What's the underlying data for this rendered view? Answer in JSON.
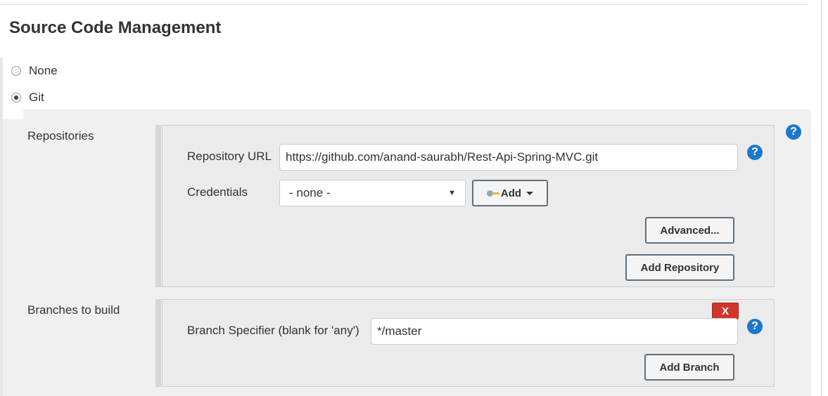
{
  "section": {
    "title": "Source Code Management"
  },
  "scm_options": [
    {
      "label": "None",
      "selected": false
    },
    {
      "label": "Git",
      "selected": true
    }
  ],
  "repositories": {
    "label": "Repositories",
    "url_label": "Repository URL",
    "url_value": "https://github.com/anand-saurabh/Rest-Api-Spring-MVC.git",
    "credentials_label": "Credentials",
    "credentials_selected": "- none -",
    "add_button": "Add",
    "advanced_button": "Advanced...",
    "add_repository_button": "Add Repository"
  },
  "branches": {
    "label": "Branches to build",
    "specifier_label": "Branch Specifier (blank for 'any')",
    "specifier_value": "*/master",
    "delete_button": "X",
    "add_branch_button": "Add Branch"
  },
  "help_glyph": "?",
  "colors": {
    "help_icon": "#1b79c9",
    "delete_button": "#d0362b",
    "button_border": "#607080",
    "panel_background": "#f0f0f0"
  }
}
